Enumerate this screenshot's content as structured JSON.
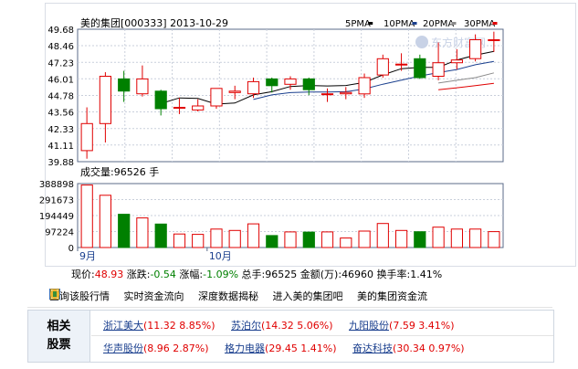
{
  "header": {
    "title": "美的集团[000333] 2013-10-29",
    "ma_labels": [
      "5PMA",
      "10PMA",
      "20PMA",
      "30PMA"
    ],
    "ma_colors": [
      "#000000",
      "#1a3f8e",
      "#8a8a8a",
      "#e00000"
    ]
  },
  "watermark": "东方财富网",
  "chart_data": {
    "type": "candlestick",
    "price_ticks": [
      "49.68",
      "48.46",
      "47.23",
      "46.01",
      "44.78",
      "43.56",
      "42.33",
      "41.11",
      "39.88"
    ],
    "ylim": [
      39.88,
      49.68
    ],
    "volume_label": "成交量:96526 手",
    "volume_ticks": [
      "388898",
      "291673",
      "194449",
      "97224",
      "0"
    ],
    "volume_ylim": [
      0,
      388898
    ],
    "x_labels": [
      {
        "label": "9月",
        "index": 0
      },
      {
        "label": "10月",
        "index": 7
      }
    ],
    "candles": [
      {
        "o": 40.7,
        "c": 42.7,
        "h": 43.9,
        "l": 40.1
      },
      {
        "o": 42.7,
        "c": 46.2,
        "h": 46.5,
        "l": 41.3
      },
      {
        "o": 46.0,
        "c": 45.1,
        "h": 46.6,
        "l": 44.3
      },
      {
        "o": 44.9,
        "c": 46.0,
        "h": 47.0,
        "l": 44.7
      },
      {
        "o": 45.1,
        "c": 43.8,
        "h": 45.2,
        "l": 43.3
      },
      {
        "o": 43.9,
        "c": 43.9,
        "h": 44.6,
        "l": 43.4
      },
      {
        "o": 43.7,
        "c": 44.0,
        "h": 44.5,
        "l": 43.6
      },
      {
        "o": 44.0,
        "c": 45.3,
        "h": 45.3,
        "l": 43.8
      },
      {
        "o": 45.0,
        "c": 45.1,
        "h": 45.5,
        "l": 44.5
      },
      {
        "o": 44.9,
        "c": 45.8,
        "h": 46.1,
        "l": 44.6
      },
      {
        "o": 46.0,
        "c": 45.5,
        "h": 46.1,
        "l": 45.0
      },
      {
        "o": 45.6,
        "c": 46.0,
        "h": 46.2,
        "l": 45.2
      },
      {
        "o": 46.0,
        "c": 45.2,
        "h": 46.1,
        "l": 44.8
      },
      {
        "o": 44.9,
        "c": 44.9,
        "h": 45.3,
        "l": 44.3
      },
      {
        "o": 44.9,
        "c": 45.0,
        "h": 45.4,
        "l": 44.5
      },
      {
        "o": 44.9,
        "c": 46.1,
        "h": 46.4,
        "l": 44.6
      },
      {
        "o": 46.3,
        "c": 47.5,
        "h": 47.8,
        "l": 46.1
      },
      {
        "o": 47.1,
        "c": 47.1,
        "h": 47.9,
        "l": 46.6
      },
      {
        "o": 47.5,
        "c": 46.1,
        "h": 47.8,
        "l": 46.0
      },
      {
        "o": 46.2,
        "c": 47.2,
        "h": 48.7,
        "l": 45.9
      },
      {
        "o": 47.2,
        "c": 47.4,
        "h": 48.2,
        "l": 46.7
      },
      {
        "o": 47.5,
        "c": 48.9,
        "h": 49.3,
        "l": 47.3
      },
      {
        "o": 48.9,
        "c": 48.9,
        "h": 49.5,
        "l": 48.0
      }
    ],
    "volumes": [
      380000,
      318000,
      202000,
      180000,
      143000,
      82000,
      80000,
      112000,
      104000,
      144000,
      73000,
      95000,
      94000,
      95000,
      58000,
      100000,
      146000,
      104000,
      96000,
      124000,
      112000,
      112000,
      96526
    ],
    "ma5": [
      null,
      null,
      null,
      null,
      44.18,
      44.6,
      44.56,
      44.14,
      44.22,
      44.82,
      45.06,
      45.44,
      45.52,
      45.48,
      45.52,
      45.74,
      46.3,
      46.76,
      46.86,
      46.86,
      47.4,
      47.76,
      48.04
    ],
    "ma10": [
      null,
      null,
      null,
      null,
      null,
      null,
      null,
      null,
      null,
      44.48,
      44.82,
      44.99,
      45.04,
      45.03,
      45.06,
      45.26,
      45.61,
      45.91,
      46.21,
      46.47,
      46.7,
      47.05,
      47.3
    ],
    "ma20": [
      null,
      null,
      null,
      null,
      null,
      null,
      null,
      null,
      null,
      null,
      null,
      null,
      null,
      null,
      null,
      null,
      null,
      null,
      null,
      45.7,
      45.9,
      46.1,
      46.45
    ],
    "ma30": [
      null,
      null,
      null,
      null,
      null,
      null,
      null,
      null,
      null,
      null,
      null,
      null,
      null,
      null,
      null,
      null,
      null,
      null,
      null,
      45.2,
      45.35,
      45.5,
      45.68
    ],
    "up_color": "#e00000",
    "down_color": "#008000"
  },
  "quote": {
    "price_label": "现价:",
    "price": "48.93",
    "change_label": "涨跌:",
    "change": "-0.54",
    "pct_label": "涨幅:",
    "pct": "-1.09%",
    "total_hands_label": "总手:",
    "total_hands": "96525",
    "amount_label": "金额(万):",
    "amount": "46960",
    "turnover_label": "换手率:",
    "turnover": "1.41%"
  },
  "links": [
    {
      "label": "查询该股行情",
      "icon": "chart-icon"
    },
    {
      "label": "实时资金流向",
      "icon": "bar-chart-icon"
    },
    {
      "label": "深度数据揭秘",
      "icon": "document-icon"
    },
    {
      "label": "进入美的集团吧",
      "icon": "forum-icon"
    },
    {
      "label": "美的集团资金流",
      "icon": "money-flow-icon"
    }
  ],
  "related": {
    "title_line1": "相关",
    "title_line2": "股票",
    "row1": [
      {
        "name": "浙江美大",
        "info": "(11.32 8.85%)"
      },
      {
        "name": "苏泊尔",
        "info": "(14.32 5.06%)"
      },
      {
        "name": "九阳股份",
        "info": "(7.59 3.41%)"
      }
    ],
    "row2": [
      {
        "name": "华声股份",
        "info": "(8.96 2.87%)"
      },
      {
        "name": "格力电器",
        "info": "(29.45 1.41%)"
      },
      {
        "name": "奋达科技",
        "info": "(30.34 0.97%)"
      }
    ]
  }
}
